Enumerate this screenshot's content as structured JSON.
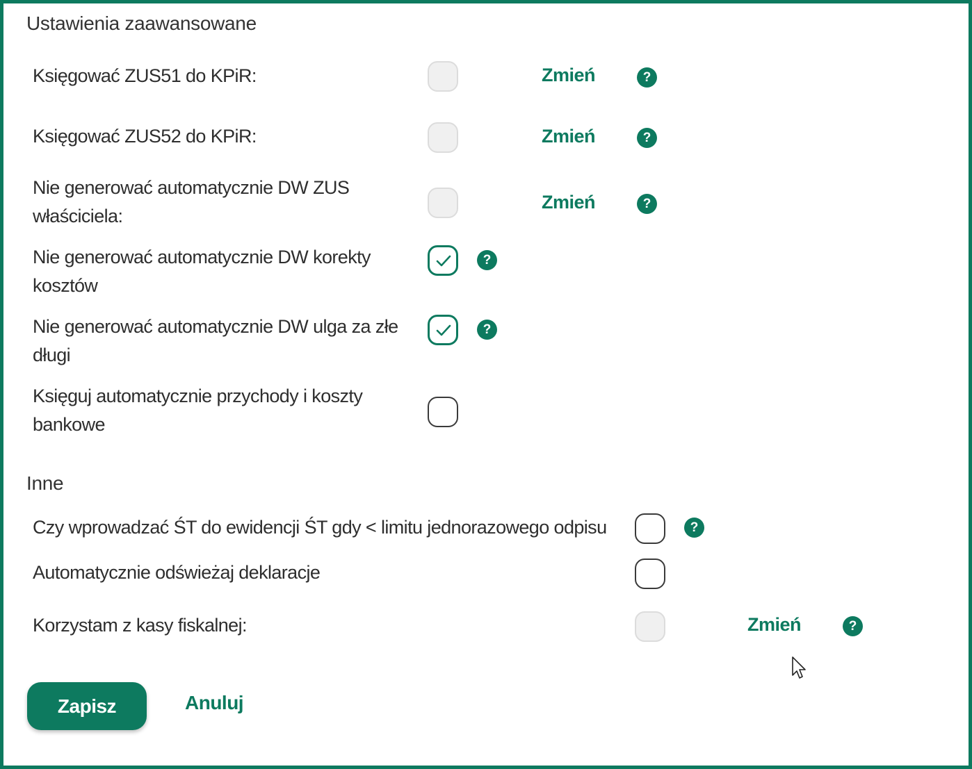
{
  "sections": {
    "advanced_title": "Ustawienia zaawansowane",
    "other_title": "Inne"
  },
  "settings": [
    {
      "line1": "Księgować ZUS51 do KPiR:",
      "line2": "",
      "state": "disabled",
      "change_label": "Zmień",
      "help": "?"
    },
    {
      "line1": "Księgować ZUS52 do KPiR:",
      "line2": "",
      "state": "disabled",
      "change_label": "Zmień",
      "help": "?"
    },
    {
      "line1": "Nie generować automatycznie DW ZUS",
      "line2": "właściciela:",
      "state": "disabled",
      "change_label": "Zmień",
      "help": "?"
    },
    {
      "line1": "Nie generować automatycznie DW korekty",
      "line2": "kosztów",
      "state": "checked",
      "help": "?"
    },
    {
      "line1": "Nie generować automatycznie DW ulga za złe",
      "line2": "długi",
      "state": "checked",
      "help": "?"
    },
    {
      "line1": "Księguj automatycznie przychody i koszty",
      "line2": "bankowe",
      "state": "unchecked"
    }
  ],
  "other": [
    {
      "label": "Czy wprowadzać ŚT do ewidencji ŚT gdy < limitu jednorazowego odpisu",
      "state": "unchecked",
      "help": "?"
    },
    {
      "label": "Automatycznie odświeżaj deklaracje",
      "state": "unchecked"
    },
    {
      "label": "Korzystam z kasy fiskalnej:",
      "state": "disabled",
      "change_label": "Zmień",
      "help": "?"
    }
  ],
  "actions": {
    "save_label": "Zapisz",
    "cancel_label": "Anuluj"
  },
  "colors": {
    "accent": "#0d7a5f",
    "border": "#0d7a5f",
    "disabled_fill": "#f0f0f0"
  },
  "icons": {
    "help": "question-circle-icon",
    "check": "check-icon",
    "cursor": "mouse-pointer-icon"
  }
}
